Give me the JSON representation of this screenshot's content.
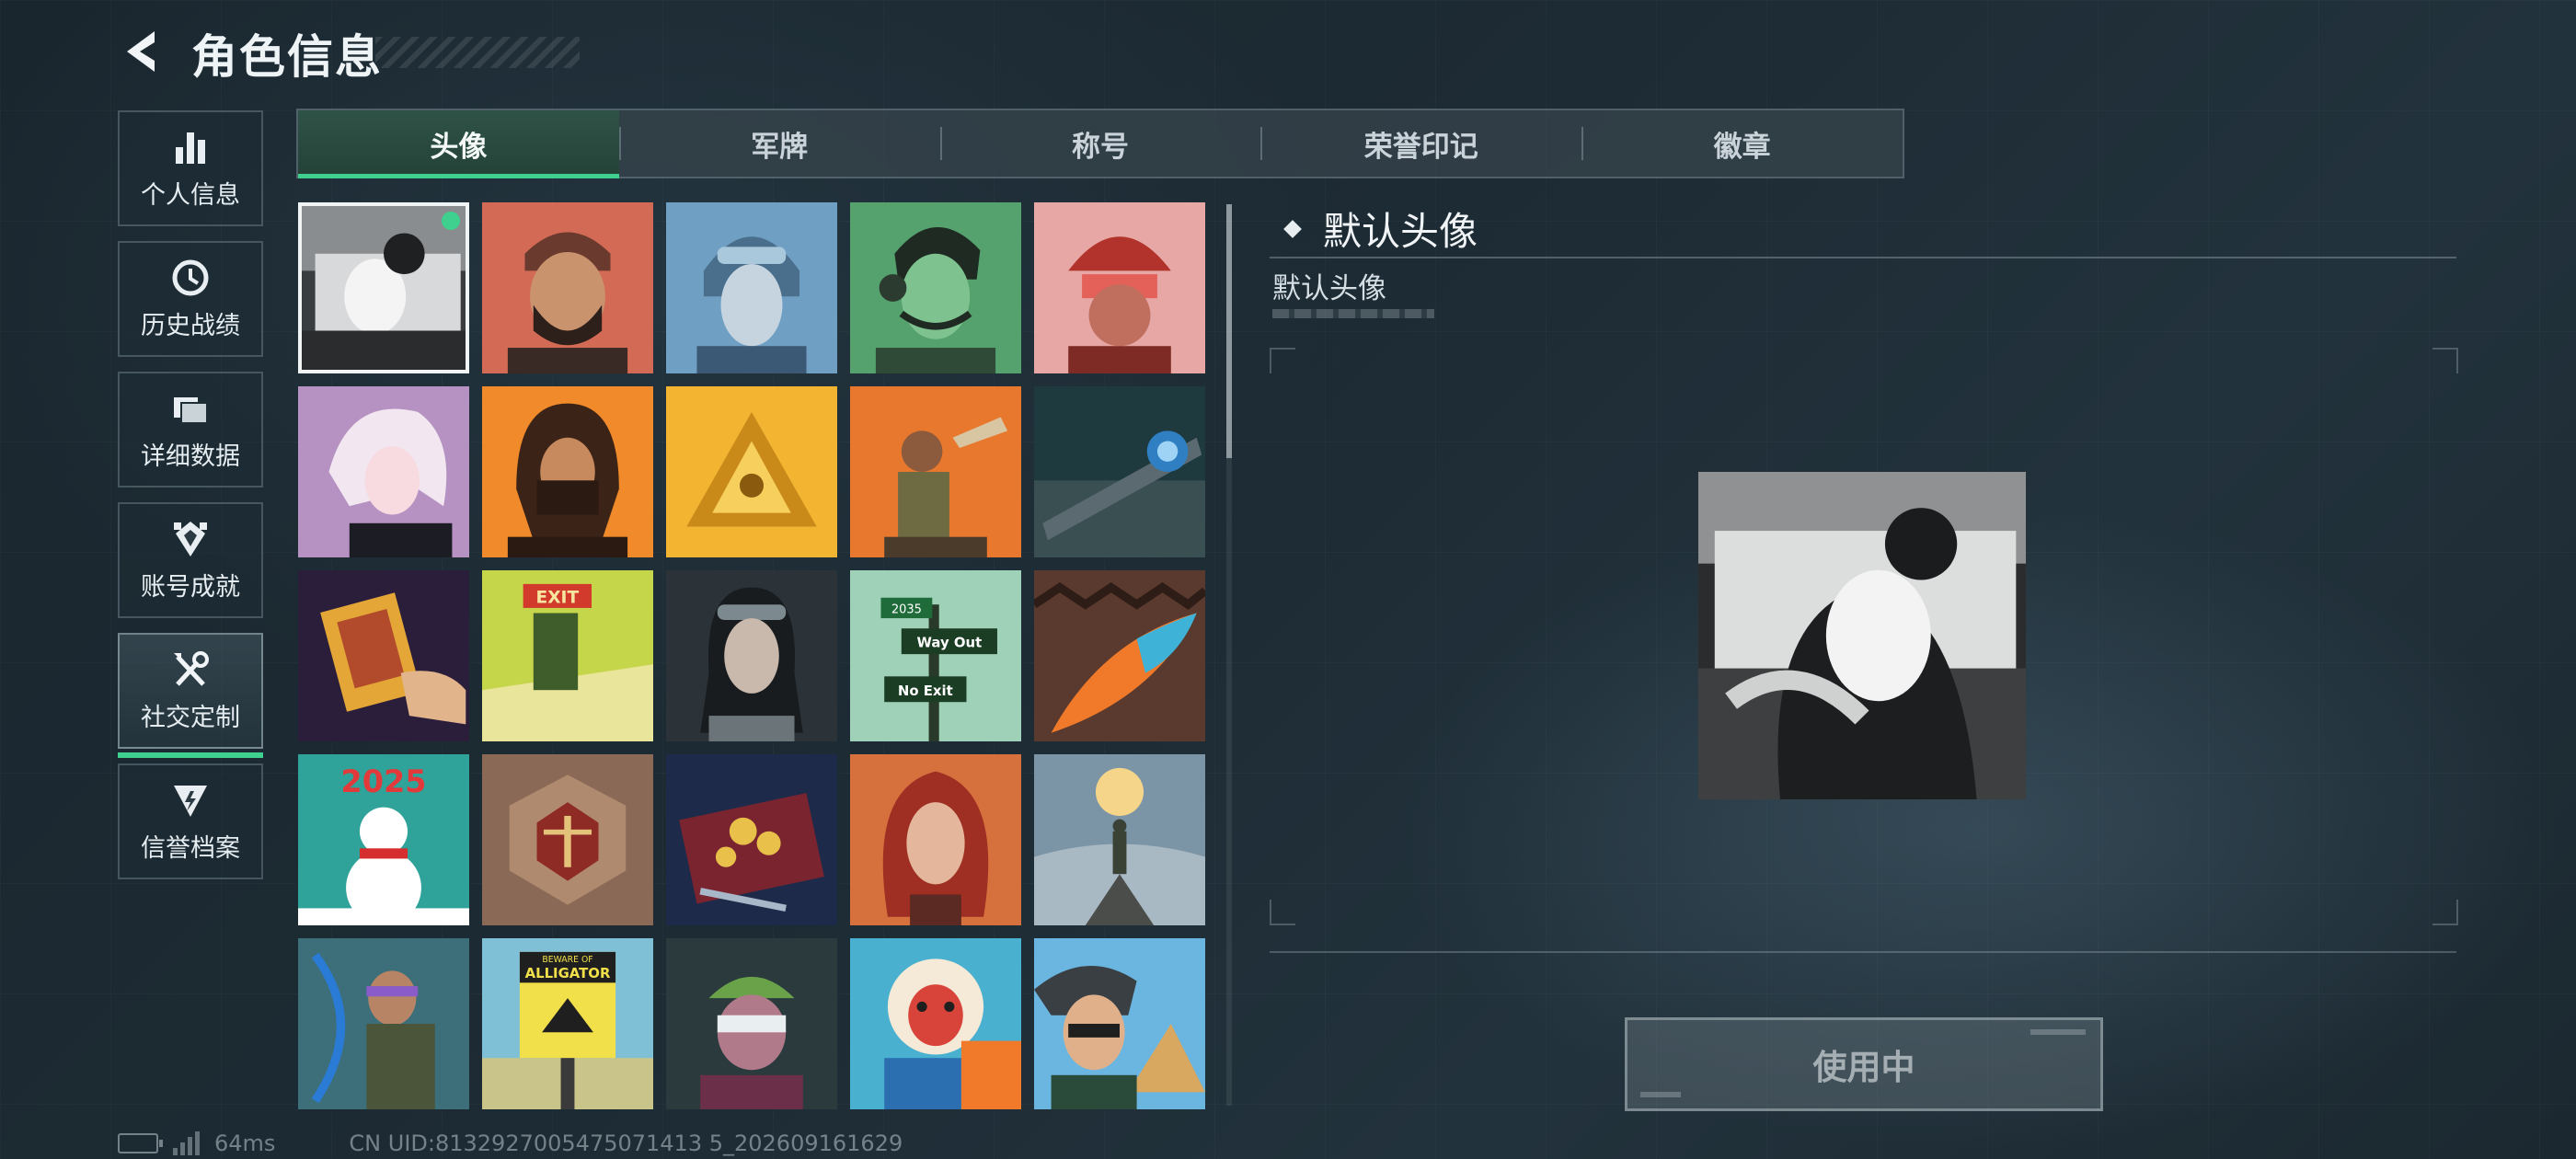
{
  "header": {
    "title": "角色信息"
  },
  "sidebar": {
    "items": [
      {
        "label": "个人信息",
        "icon": "bar-chart-icon",
        "active": false
      },
      {
        "label": "历史战绩",
        "icon": "clock-history-icon",
        "active": false
      },
      {
        "label": "详细数据",
        "icon": "folder-data-icon",
        "active": false
      },
      {
        "label": "账号成就",
        "icon": "achievement-badge-icon",
        "active": false
      },
      {
        "label": "社交定制",
        "icon": "wrench-screwdriver-icon",
        "active": true
      },
      {
        "label": "信誉档案",
        "icon": "reputation-shield-icon",
        "active": false
      }
    ]
  },
  "tabs": [
    {
      "label": "头像",
      "active": true
    },
    {
      "label": "军牌",
      "active": false
    },
    {
      "label": "称号",
      "active": false
    },
    {
      "label": "荣誉印记",
      "active": false
    },
    {
      "label": "徽章",
      "active": false
    }
  ],
  "avatars": [
    {
      "theme": "default-photo-grayscale",
      "selected": true
    },
    {
      "theme": "bearded-man-cap-headset"
    },
    {
      "theme": "pilot-woman-goggles"
    },
    {
      "theme": "man-green-headset"
    },
    {
      "theme": "soldier-red-helmet"
    },
    {
      "theme": "white-hair-girl"
    },
    {
      "theme": "masked-long-hair-man"
    },
    {
      "theme": "golden-triangle-emblem"
    },
    {
      "theme": "soldier-throwing-drone"
    },
    {
      "theme": "sniper-rifle-scope"
    },
    {
      "theme": "hand-holding-book"
    },
    {
      "theme": "exit-door-figure"
    },
    {
      "theme": "girl-with-goggles"
    },
    {
      "theme": "street-sign-way-out"
    },
    {
      "theme": "feather-pattern"
    },
    {
      "theme": "snowman-2025"
    },
    {
      "theme": "scales-of-justice-emblem"
    },
    {
      "theme": "treasure-chest-coins"
    },
    {
      "theme": "red-hair-woman"
    },
    {
      "theme": "hiker-on-mountain"
    },
    {
      "theme": "archer-with-bow"
    },
    {
      "theme": "beware-alligator-sign"
    },
    {
      "theme": "masked-green-hat-figure"
    },
    {
      "theme": "monkey-reading-book"
    },
    {
      "theme": "man-glasses-pyramids"
    }
  ],
  "avatar_text": {
    "exit_sign": "EXIT",
    "sign_year": "2035",
    "sign_way_out": "Way Out",
    "sign_no_exit": "No Exit",
    "snowman_year": "2025",
    "alligator_top": "BEWARE OF",
    "alligator_main": "ALLIGATOR"
  },
  "detail": {
    "heading": "默认头像",
    "subtitle": "默认头像",
    "button_label": "使用中"
  },
  "status_bar": {
    "ping": "64ms",
    "uid": "CN UID:8132927005475071413 5_202609161629"
  },
  "colors": {
    "accent": "#3fcf8e",
    "background": "#1d2b34"
  }
}
